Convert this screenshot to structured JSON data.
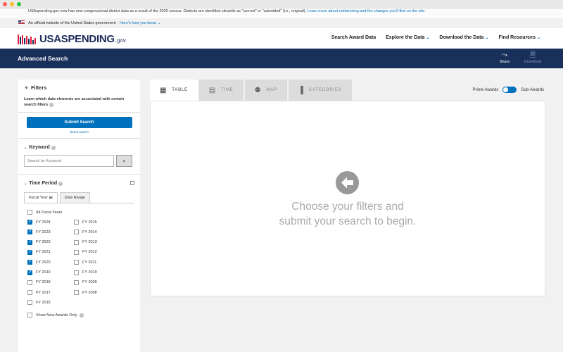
{
  "notice": {
    "text": "USAspending.gov now has new congressional district data as a result of the 2020 census. Districts are identified sitewide as \"current\" or \"submitted\" (i.e., original).",
    "link": "Learn more about redistricting and the changes you'll find on the site."
  },
  "gov_banner": {
    "text": "An official website of the United States government",
    "link": "Here's how you know"
  },
  "header": {
    "logo_main": "USASPENDING",
    "logo_suffix": ".gov",
    "nav": [
      {
        "label": "Search Award Data",
        "dropdown": false
      },
      {
        "label": "Explore the Data",
        "dropdown": true
      },
      {
        "label": "Download the Data",
        "dropdown": true
      },
      {
        "label": "Find Resources",
        "dropdown": true
      }
    ]
  },
  "page_bar": {
    "title": "Advanced Search",
    "share_label": "Share",
    "download_label": "Download"
  },
  "sidebar": {
    "title": "Filters",
    "description": "Learn which data elements are associated with certain search filters",
    "submit_label": "Submit Search",
    "reset_label": "Reset search",
    "keyword": {
      "title": "Keyword",
      "placeholder": "Search by Keyword"
    },
    "time_period": {
      "title": "Time Period",
      "tabs": [
        "Fiscal Year",
        "Date Range"
      ],
      "all_label": "All Fiscal Years",
      "years_left": [
        {
          "label": "FY 2024",
          "checked": true
        },
        {
          "label": "FY 2023",
          "checked": true
        },
        {
          "label": "FY 2022",
          "checked": true
        },
        {
          "label": "FY 2021",
          "checked": true
        },
        {
          "label": "FY 2020",
          "checked": true
        },
        {
          "label": "FY 2019",
          "checked": true
        },
        {
          "label": "FY 2018",
          "checked": false
        },
        {
          "label": "FY 2017",
          "checked": false
        },
        {
          "label": "FY 2016",
          "checked": false
        }
      ],
      "years_right": [
        {
          "label": "FY 2015",
          "checked": false
        },
        {
          "label": "FY 2014",
          "checked": false
        },
        {
          "label": "FY 2013",
          "checked": false
        },
        {
          "label": "FY 2012",
          "checked": false
        },
        {
          "label": "FY 2011",
          "checked": false
        },
        {
          "label": "FY 2010",
          "checked": false
        },
        {
          "label": "FY 2009",
          "checked": false
        },
        {
          "label": "FY 2008",
          "checked": false
        }
      ],
      "new_awards_label": "Show New Awards Only"
    }
  },
  "main": {
    "tabs": [
      {
        "label": "TABLE",
        "icon": "table-icon"
      },
      {
        "label": "TIME",
        "icon": "calendar-icon"
      },
      {
        "label": "MAP",
        "icon": "map-pin-icon"
      },
      {
        "label": "CATEGORIES",
        "icon": "bar-chart-icon"
      }
    ],
    "active_tab": "TABLE",
    "toggle_left": "Prime Awards",
    "toggle_right": "Sub-Awards",
    "empty_line1": "Choose your filters and",
    "empty_line2": "submit your search to begin."
  },
  "colors": {
    "brand_navy": "#19305a",
    "link_blue": "#0071bc",
    "flag_red": "#e31c3d"
  }
}
